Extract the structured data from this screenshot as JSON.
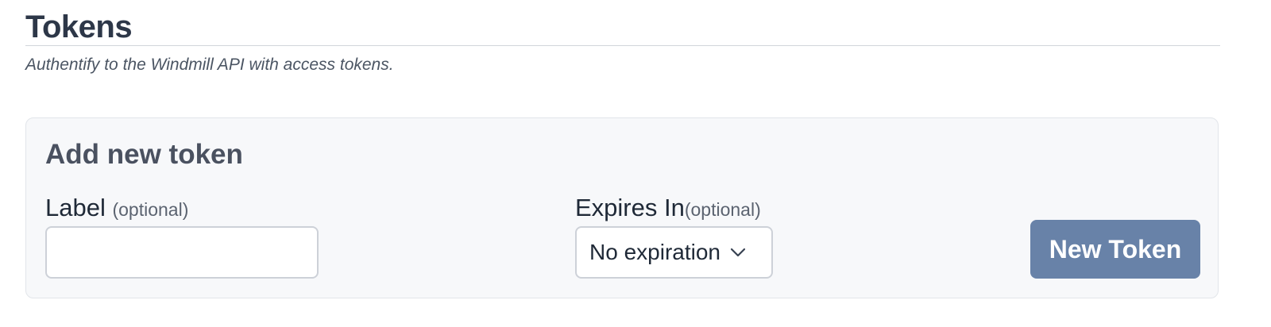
{
  "header": {
    "title": "Tokens",
    "subtitle": "Authentify to the Windmill API with access tokens."
  },
  "card": {
    "title": "Add new token",
    "label_field": {
      "label": "Label",
      "optional": "(optional)",
      "value": ""
    },
    "expires_field": {
      "label": "Expires In",
      "optional": "(optional)",
      "selected": "No expiration",
      "icon": "chevron-down-icon"
    },
    "submit_label": "New Token"
  },
  "colors": {
    "button": "#6882a8",
    "card_bg": "#f7f8fa",
    "title": "#2d3748"
  }
}
